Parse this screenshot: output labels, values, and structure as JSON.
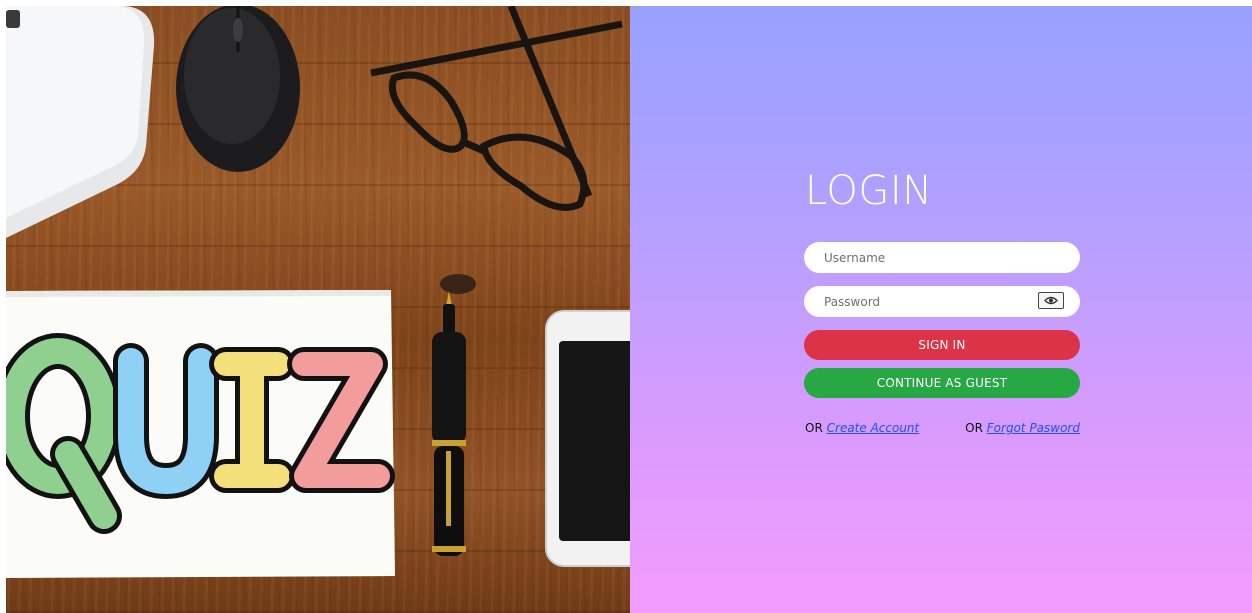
{
  "hero": {
    "image_word": "QUIZ",
    "letters": [
      {
        "char": "Q",
        "color": "#8fcf8f"
      },
      {
        "char": "U",
        "color": "#8fd1f5"
      },
      {
        "char": "I",
        "color": "#f3e07a"
      },
      {
        "char": "Z",
        "color": "#f39c9c"
      }
    ]
  },
  "login": {
    "title": "LOGIN",
    "username_placeholder": "Username",
    "password_placeholder": "Password",
    "signin_label": "SIGN IN",
    "guest_label": "CONTINUE AS GUEST",
    "create_prefix": "OR",
    "create_link": "Create Account",
    "forgot_prefix": "OR",
    "forgot_link": "Forgot Pasword",
    "show_password_icon": "eye-icon"
  },
  "colors": {
    "signin": "#dc3446",
    "guest": "#28a745",
    "link": "#1d4fff",
    "panel_top": "#97a1ff",
    "panel_bottom": "#f39cfd"
  }
}
